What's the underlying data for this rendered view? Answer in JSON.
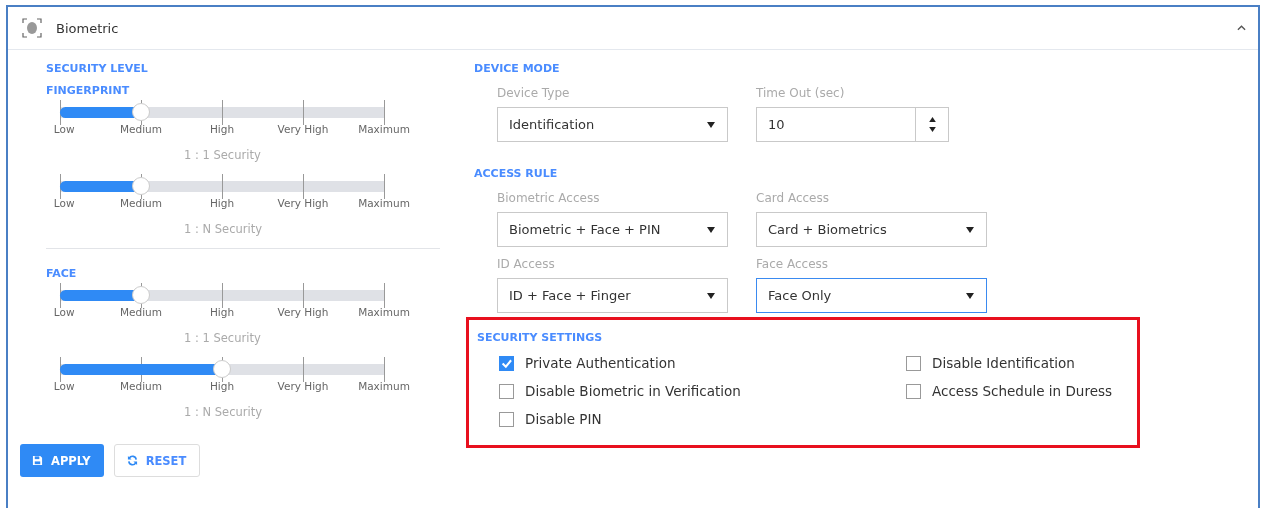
{
  "panel": {
    "title": "Biometric",
    "expanded": true
  },
  "security_level": {
    "heading": "SECURITY LEVEL",
    "groups": [
      {
        "heading": "FINGERPRINT",
        "sliders": [
          {
            "level": 0.25,
            "ticks": [
              "Low",
              "Medium",
              "High",
              "Very High",
              "Maximum"
            ],
            "caption": "1 : 1 Security"
          },
          {
            "level": 0.25,
            "ticks": [
              "Low",
              "Medium",
              "High",
              "Very High",
              "Maximum"
            ],
            "caption": "1 : N Security"
          }
        ]
      },
      {
        "heading": "FACE",
        "sliders": [
          {
            "level": 0.25,
            "ticks": [
              "Low",
              "Medium",
              "High",
              "Very High",
              "Maximum"
            ],
            "caption": "1 : 1 Security"
          },
          {
            "level": 0.5,
            "ticks": [
              "Low",
              "Medium",
              "High",
              "Very High",
              "Maximum"
            ],
            "caption": "1 : N Security"
          }
        ]
      }
    ]
  },
  "device_mode": {
    "heading": "DEVICE MODE",
    "fields": [
      {
        "kind": "select",
        "label": "Device Type",
        "value": "Identification",
        "focused": false
      },
      {
        "kind": "number",
        "label": "Time Out (sec)",
        "value": "10",
        "focused": false
      }
    ]
  },
  "access_rule": {
    "heading": "ACCESS RULE",
    "fields": [
      {
        "kind": "select",
        "label": "Biometric Access",
        "value": "Biometric + Face + PIN",
        "focused": false
      },
      {
        "kind": "select",
        "label": "Card Access",
        "value": "Card + Biometrics",
        "focused": false
      },
      {
        "kind": "select",
        "label": "ID Access",
        "value": "ID + Face + Finger",
        "focused": false
      },
      {
        "kind": "select",
        "label": "Face Access",
        "value": "Face Only",
        "focused": true
      }
    ]
  },
  "security_settings": {
    "heading": "SECURITY SETTINGS",
    "highlighted": true,
    "columns": [
      [
        {
          "label": "Private Authentication",
          "checked": true
        },
        {
          "label": "Disable Biometric in Verification",
          "checked": false
        },
        {
          "label": "Disable PIN",
          "checked": false
        }
      ],
      [
        {
          "label": "Disable Identification",
          "checked": false
        },
        {
          "label": "Access Schedule in Duress",
          "checked": false
        }
      ]
    ]
  },
  "buttons": [
    {
      "kind": "apply",
      "label": "APPLY"
    },
    {
      "kind": "reset",
      "label": "RESET"
    }
  ]
}
